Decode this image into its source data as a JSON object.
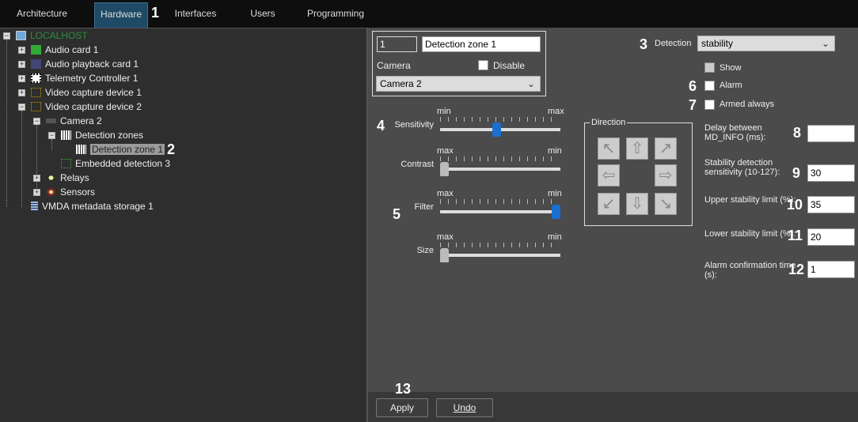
{
  "tabs": [
    {
      "label": "Architecture"
    },
    {
      "label": "Hardware",
      "active": true
    },
    {
      "label": "Interfaces"
    },
    {
      "label": "Users"
    },
    {
      "label": "Programming"
    }
  ],
  "markers": [
    "1",
    "2",
    "3",
    "4",
    "5",
    "6",
    "7",
    "8",
    "9",
    "10",
    "11",
    "12",
    "13"
  ],
  "tree": {
    "items": [
      {
        "label": "LOCALHOST",
        "icon": "computer-icon"
      },
      {
        "label": "Audio card 1",
        "icon": "audio-card-icon"
      },
      {
        "label": "Audio playback card 1",
        "icon": "audio-playback-icon"
      },
      {
        "label": "Telemetry Controller 1",
        "icon": "telemetry-icon"
      },
      {
        "label": "Video capture device 1",
        "icon": "video-capture-icon"
      },
      {
        "label": "Video capture device 2",
        "icon": "video-capture-icon"
      },
      {
        "label": "Camera 2",
        "icon": "camera-icon"
      },
      {
        "label": "Detection zones",
        "icon": "grid-icon"
      },
      {
        "label": "Detection zone 1",
        "icon": "grid-icon",
        "selected": true
      },
      {
        "label": "Embedded detection 3",
        "icon": "detector-icon"
      },
      {
        "label": "Relays",
        "icon": "relay-icon"
      },
      {
        "label": "Sensors",
        "icon": "sensor-icon"
      },
      {
        "label": "VMDA metadata storage 1",
        "icon": "database-icon"
      }
    ]
  },
  "zone": {
    "id": "1",
    "name": "Detection zone 1",
    "camera_label": "Camera",
    "camera_value": "Camera 2",
    "disable_label": "Disable",
    "disable_checked": false
  },
  "detection": {
    "label": "Detection",
    "value": "stability"
  },
  "checkboxes": {
    "show": "Show",
    "alarm": "Alarm",
    "armed_always": "Armed always"
  },
  "sliders": [
    {
      "label": "Sensitivity",
      "left": "min",
      "right": "max",
      "level": 0.47,
      "color": "#1a6fd0"
    },
    {
      "label": "Contrast",
      "left": "max",
      "right": "min",
      "level": 0.0,
      "color": "#bbbbbb"
    },
    {
      "label": "Filter",
      "left": "max",
      "right": "min",
      "level": 1.0,
      "color": "#1a6fd0"
    },
    {
      "label": "Size",
      "left": "max",
      "right": "min",
      "level": 0.0,
      "color": "#bbbbbb"
    }
  ],
  "direction": {
    "label": "Direction"
  },
  "fields": [
    {
      "label1": "Delay between",
      "label2": "MD_INFO (ms):",
      "value": ""
    },
    {
      "label1": "Stability detection",
      "label2": "sensitivity (10-127):",
      "value": "30"
    },
    {
      "label1": "Upper stability limit (%):",
      "label2": "",
      "value": "35"
    },
    {
      "label1": "Lower stability limit (%):",
      "label2": "",
      "value": "20"
    },
    {
      "label1": "Alarm confirmation time",
      "label2": "(s):",
      "value": "1"
    }
  ],
  "buttons": {
    "apply": "Apply",
    "undo": "Undo"
  }
}
